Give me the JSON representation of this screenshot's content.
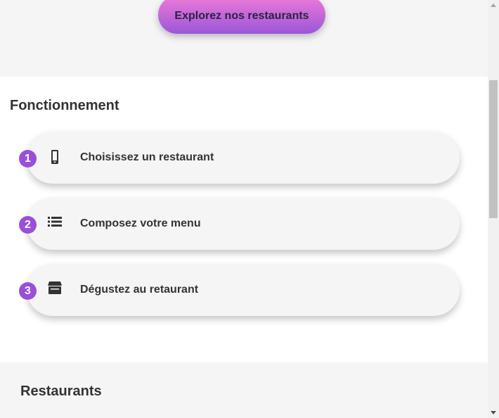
{
  "hero": {
    "cta_label": "Explorez nos restaurants"
  },
  "how_it_works": {
    "title": "Fonctionnement",
    "steps": [
      {
        "number": "1",
        "icon": "smartphone-icon",
        "label": "Choisissez un restaurant"
      },
      {
        "number": "2",
        "icon": "list-icon",
        "label": "Composez votre menu"
      },
      {
        "number": "3",
        "icon": "store-icon",
        "label": "Dégustez au retaurant"
      }
    ]
  },
  "restaurants": {
    "title": "Restaurants"
  },
  "colors": {
    "accent": "#9a4fd8",
    "cta_gradient_top": "#ef7ad8",
    "cta_gradient_bottom": "#9b56d9",
    "text": "#333333",
    "section_bg": "#f5f5f5"
  }
}
